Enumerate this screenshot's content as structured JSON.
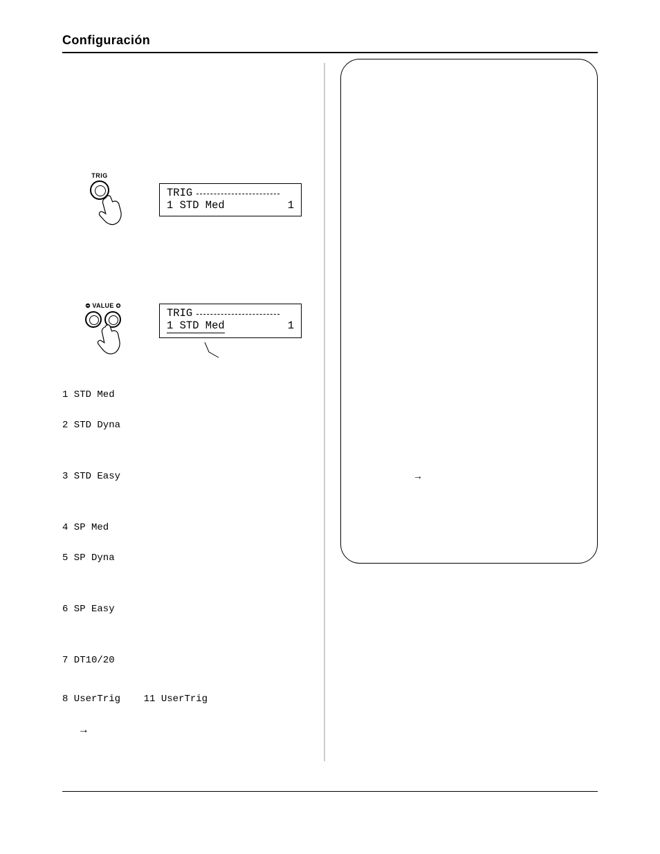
{
  "page": {
    "header": "Configuración",
    "footer_page": ""
  },
  "left": {
    "trig_label": "TRIG",
    "value_label": "VALUE",
    "lcd1": {
      "line1": "TRIG",
      "line2_left": "1 STD Med",
      "line2_right": "1"
    },
    "lcd2": {
      "line1": "TRIG",
      "line2_left": "1 STD Med",
      "line2_right": "1"
    },
    "presets": {
      "p1": "1 STD Med",
      "p2": "2 STD Dyna",
      "p3": "3 STD Easy",
      "p4": "4 SP Med",
      "p5": "5 SP Dyna",
      "p6": "6 SP Easy",
      "p7": "7 DT10/20",
      "p8a": "8 UserTrig",
      "p8b": "11 UserTrig",
      "arrow": "→"
    }
  },
  "right": {
    "panel_arrow": "→"
  }
}
